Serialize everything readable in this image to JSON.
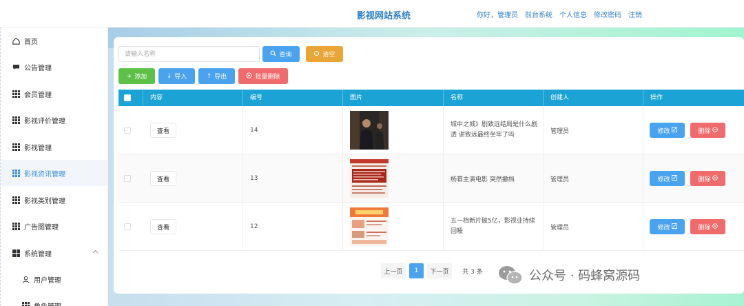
{
  "header": {
    "title": "影视网站系统",
    "links": [
      "你好，管理员",
      "前台系统",
      "个人信息",
      "修改密码",
      "注销"
    ]
  },
  "sidebar": {
    "items": [
      {
        "label": "首页",
        "icon": "home-icon"
      },
      {
        "label": "公告管理",
        "icon": "message-icon"
      },
      {
        "label": "会员管理",
        "icon": "grid-icon"
      },
      {
        "label": "影视评价管理",
        "icon": "grid-icon"
      },
      {
        "label": "影视管理",
        "icon": "grid-icon"
      },
      {
        "label": "影视资讯管理",
        "icon": "grid-icon",
        "active": true
      },
      {
        "label": "影视类别管理",
        "icon": "grid-icon"
      },
      {
        "label": "广告图管理",
        "icon": "grid-icon"
      },
      {
        "label": "系统管理",
        "icon": "apps-icon",
        "expanded": true
      },
      {
        "label": "用户管理",
        "icon": "user-icon",
        "sub": true
      },
      {
        "label": "角色管理",
        "icon": "grid-icon",
        "sub": true
      }
    ]
  },
  "search": {
    "placeholder": "请输入名称",
    "query_label": "查询",
    "clear_label": "清空"
  },
  "toolbar": {
    "add_label": "添加",
    "import_label": "导入",
    "export_label": "导出",
    "batch_delete_label": "批量删除"
  },
  "table": {
    "headers": [
      "内容",
      "编号",
      "图片",
      "名称",
      "创建人",
      "操作"
    ],
    "view_label": "查看",
    "edit_label": "修改",
    "delete_label": "删除",
    "rows": [
      {
        "id": "14",
        "name": "城中之城》剧致远结局是什么剧透 谢致远最终坐牢了吗",
        "creator": "管理员"
      },
      {
        "id": "13",
        "name": "杨幂主演电影 突然撤档",
        "creator": "管理员"
      },
      {
        "id": "12",
        "name": "五一档新片破5亿，影视业持续回暖",
        "creator": "管理员"
      }
    ]
  },
  "pagination": {
    "prev_label": "上一页",
    "current_page": "1",
    "next_label": "下一页",
    "total_label": "共 3 条"
  },
  "watermark": {
    "text": "公众号 · 码蜂窝源码"
  },
  "colors": {
    "accent": "#4aa3ef",
    "table_header": "#1aa3d4",
    "danger": "#f06b6b",
    "success": "#5cc146",
    "warning": "#e9a535"
  }
}
